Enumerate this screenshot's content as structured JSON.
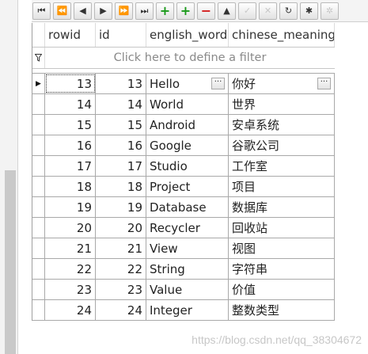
{
  "toolbar": {
    "buttons": [
      {
        "name": "first-record",
        "glyph": "⏮"
      },
      {
        "name": "prior-page",
        "glyph": "⏪"
      },
      {
        "name": "prior-record",
        "glyph": "◀"
      },
      {
        "name": "next-record",
        "glyph": "▶"
      },
      {
        "name": "next-page",
        "glyph": "⏩"
      },
      {
        "name": "last-record",
        "glyph": "⏭"
      },
      {
        "name": "insert-record",
        "glyph": "+"
      },
      {
        "name": "insert-record-plus",
        "glyph": "+"
      },
      {
        "name": "delete-record",
        "glyph": "−"
      },
      {
        "name": "edit-record",
        "glyph": "▲"
      },
      {
        "name": "post-edit",
        "glyph": "✓"
      },
      {
        "name": "cancel-edit",
        "glyph": "✕"
      },
      {
        "name": "refresh",
        "glyph": "↻"
      },
      {
        "name": "apply-filter",
        "glyph": "✱"
      },
      {
        "name": "clear-filter",
        "glyph": "✲"
      }
    ]
  },
  "grid": {
    "columns": [
      "rowid",
      "id",
      "english_word",
      "chinese_meaning"
    ],
    "filter_placeholder": "Click here to define a filter",
    "filter_icon": "funnel-icon",
    "ellipsis": "···",
    "rows": [
      {
        "rowid": "13",
        "id": "13",
        "english_word": "Hello",
        "chinese_meaning": "你好"
      },
      {
        "rowid": "14",
        "id": "14",
        "english_word": "World",
        "chinese_meaning": "世界"
      },
      {
        "rowid": "15",
        "id": "15",
        "english_word": "Android",
        "chinese_meaning": "安卓系统"
      },
      {
        "rowid": "16",
        "id": "16",
        "english_word": "Google",
        "chinese_meaning": "谷歌公司"
      },
      {
        "rowid": "17",
        "id": "17",
        "english_word": "Studio",
        "chinese_meaning": "工作室"
      },
      {
        "rowid": "18",
        "id": "18",
        "english_word": "Project",
        "chinese_meaning": "项目"
      },
      {
        "rowid": "19",
        "id": "19",
        "english_word": "Database",
        "chinese_meaning": "数据库"
      },
      {
        "rowid": "20",
        "id": "20",
        "english_word": "Recycler",
        "chinese_meaning": "回收站"
      },
      {
        "rowid": "21",
        "id": "21",
        "english_word": "View",
        "chinese_meaning": "视图"
      },
      {
        "rowid": "22",
        "id": "22",
        "english_word": "String",
        "chinese_meaning": "字符串"
      },
      {
        "rowid": "23",
        "id": "23",
        "english_word": "Value",
        "chinese_meaning": "价值"
      },
      {
        "rowid": "24",
        "id": "24",
        "english_word": "Integer",
        "chinese_meaning": "整数类型"
      }
    ]
  },
  "watermark": "https://blog.csdn.net/qq_38304672"
}
